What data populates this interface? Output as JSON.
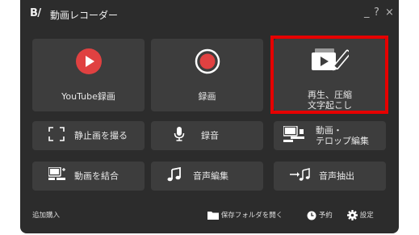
{
  "titlebar": {
    "logo": "B/",
    "title": "動画レコーダー",
    "minimize": "_",
    "help": "?",
    "close": "×"
  },
  "big_buttons": {
    "youtube": "YouTube録画",
    "record": "録画",
    "playback_line1": "再生、圧縮",
    "playback_line2": "文字起こし"
  },
  "small_buttons": {
    "still": "静止画を撮る",
    "audio": "録音",
    "video_edit_line1": "動画・",
    "video_edit_line2": "テロップ編集",
    "merge": "動画を結合",
    "audio_edit": "音声編集",
    "audio_extract": "音声抽出"
  },
  "footer": {
    "purchase": "追加購入",
    "open_folder": "保存フォルダを開く",
    "schedule": "予約",
    "settings": "設定"
  },
  "colors": {
    "background": "#2c2c2c",
    "button": "#3d3d3d",
    "record_red": "#e04141",
    "highlight": "#e60000"
  }
}
